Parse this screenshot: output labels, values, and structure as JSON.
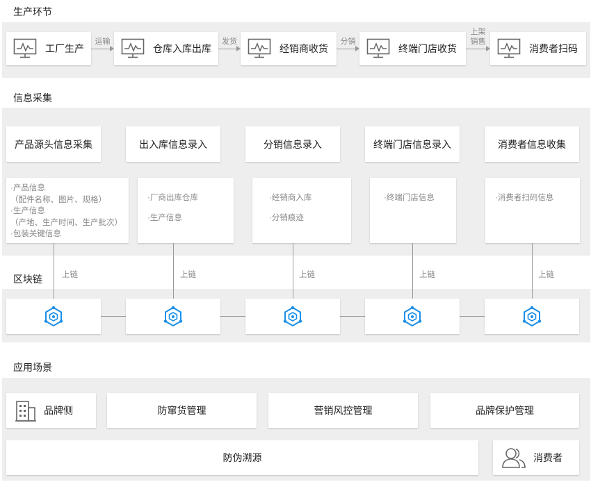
{
  "sections": {
    "production": "生产环节",
    "collection": "信息采集",
    "blockchain": "区块链",
    "application": "应用场景"
  },
  "flow": {
    "steps": [
      "工厂生产",
      "仓库入库出库",
      "经销商收货",
      "终端门店收货",
      "消费者扫码"
    ],
    "arrows": [
      "运输",
      "发货",
      "分销",
      "上架\n销售"
    ]
  },
  "collection": {
    "headers": [
      "产品源头信息采集",
      "出入库信息录入",
      "分销信息录入",
      "终端门店信息录入",
      "消费者信息收集"
    ],
    "details": [
      [
        "·产品信息",
        "（配件名称、图片、规格）",
        "·生产信息",
        "（产地、生产时间、生产批次）",
        "·包装关键信息"
      ],
      [
        "·厂商出库仓库",
        "·生产信息"
      ],
      [
        "·经销商入库",
        "·分销痕迹"
      ],
      [
        "·终端门店信息"
      ],
      [
        "·消费者扫码信息"
      ]
    ]
  },
  "chain": {
    "link_label": "上链"
  },
  "application": {
    "brand_side": "品牌侧",
    "anti_channel": "防窜货管理",
    "risk_control": "营销风控管理",
    "brand_protection": "品牌保护管理",
    "anti_counterfeit": "防伪溯源",
    "consumer": "消费者"
  },
  "colors": {
    "band": "#eeeeee",
    "icon_gray": "#666666",
    "chain_blue": "#1a8fe8"
  }
}
